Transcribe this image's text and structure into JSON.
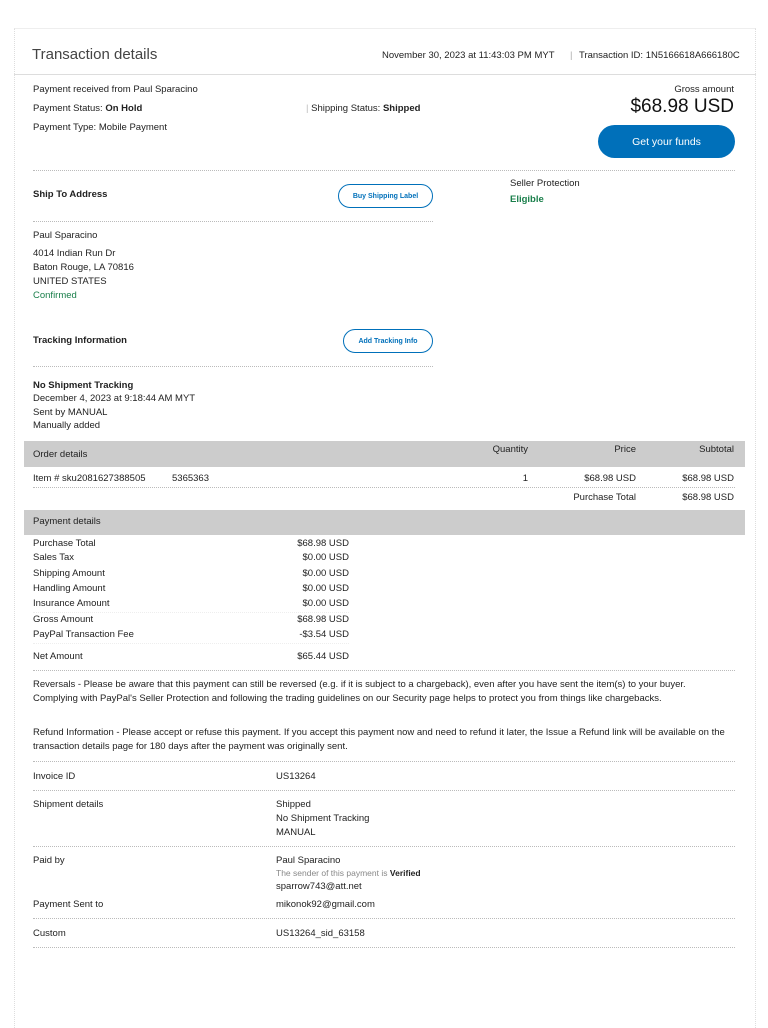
{
  "header": {
    "title": "Transaction details",
    "datetime": "November 30, 2023 at 11:43:03 PM MYT",
    "separator": "|",
    "transaction_id": "Transaction ID: 1N5166618A666180C"
  },
  "summary": {
    "received_from": "Payment received from Paul Sparacino",
    "status_label": "Payment Status:",
    "status_value": "On Hold",
    "type_label": "Payment Type:",
    "type_value": "Mobile Payment",
    "shipping_label": "Shipping Status:",
    "shipping_value": "Shipped",
    "gross_label": "Gross amount",
    "gross_value": "$68.98 USD",
    "get_funds": "Get your funds"
  },
  "ship_to": {
    "title": "Ship To Address",
    "button": "Buy Shipping Label",
    "name": "Paul Sparacino",
    "line1": "4014 Indian Run Dr",
    "line2": "Baton Rouge, LA 70816",
    "country": "UNITED STATES",
    "status": "Confirmed"
  },
  "seller_protection": {
    "label": "Seller Protection",
    "value": "Eligible"
  },
  "tracking": {
    "title": "Tracking Information",
    "button": "Add Tracking Info",
    "status": "No Shipment Tracking",
    "date": "December 4, 2023 at 9:18:44 AM MYT",
    "sent_by": "Sent by MANUAL",
    "added": "Manually added"
  },
  "order": {
    "title": "Order details",
    "col_qty": "Quantity",
    "col_price": "Price",
    "col_subtotal": "Subtotal",
    "item": "Item # sku2081627388505",
    "item_code": "5365363",
    "qty": "1",
    "price": "$68.98 USD",
    "subtotal": "$68.98 USD",
    "total_label": "Purchase Total",
    "total_value": "$68.98 USD"
  },
  "payment": {
    "title": "Payment details",
    "rows": [
      {
        "label": "Purchase Total",
        "value": "$68.98 USD"
      },
      {
        "label": "Sales Tax",
        "value": "$0.00 USD"
      },
      {
        "label": "Shipping Amount",
        "value": "$0.00 USD"
      },
      {
        "label": "Handling Amount",
        "value": "$0.00 USD"
      },
      {
        "label": "Insurance Amount",
        "value": "$0.00 USD"
      },
      {
        "label": "Gross Amount",
        "value": "$68.98 USD"
      },
      {
        "label": "PayPal Transaction Fee",
        "value": "-$3.54 USD"
      },
      {
        "label": "Net Amount",
        "value": "$65.44 USD"
      }
    ]
  },
  "notes": {
    "reversals": "Reversals - Please be aware that this payment can still be reversed (e.g. if it is subject to a chargeback), even after you have sent the item(s) to your buyer. Complying with PayPal's Seller Protection and following the trading guidelines on our Security page helps to protect you from things like chargebacks.",
    "refund": "Refund Information - Please accept or refuse this payment. If you accept this payment now and need to refund it later, the Issue a Refund link will be available on the transaction details page for 180 days after the payment was originally sent."
  },
  "details": {
    "invoice_label": "Invoice ID",
    "invoice_value": "US13264",
    "shipment_label": "Shipment details",
    "shipment_1": "Shipped",
    "shipment_2": "No Shipment Tracking",
    "shipment_3": "MANUAL",
    "paid_by_label": "Paid by",
    "paid_by_name": "Paul Sparacino",
    "verified_prefix": "The sender of this payment is",
    "verified": "Verified",
    "paid_by_email": "sparrow743@att.net",
    "sent_to_label": "Payment Sent to",
    "sent_to_value": "mikonok92@gmail.com",
    "custom_label": "Custom",
    "custom_value": "US13264_sid_63158"
  }
}
